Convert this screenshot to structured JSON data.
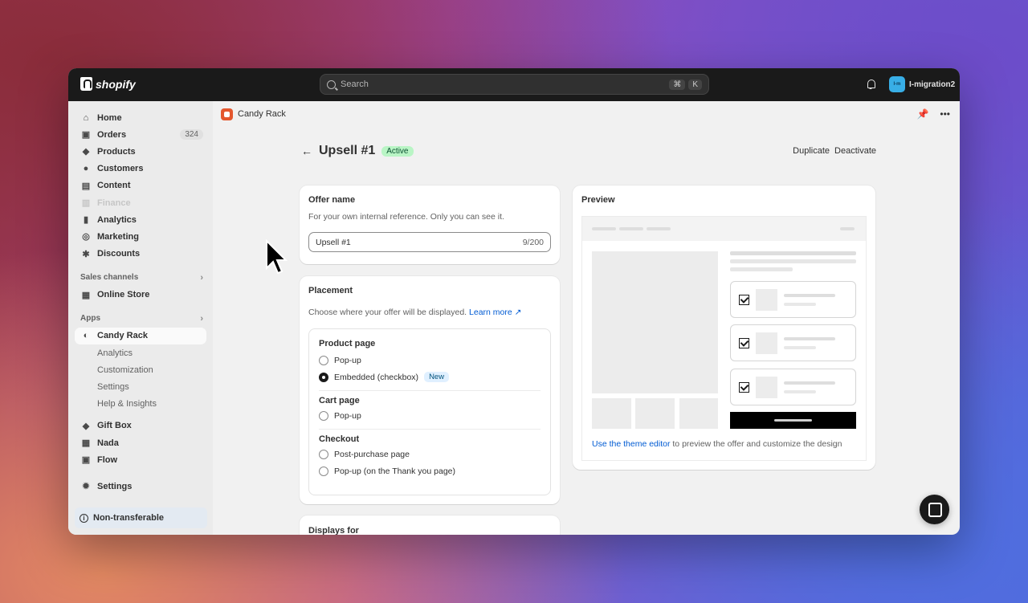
{
  "topbar": {
    "logo_text": "shopify",
    "search_placeholder": "Search",
    "shortcut_keys": [
      "⌘",
      "K"
    ],
    "user": {
      "initials": "I-m",
      "name": "I-migration2"
    }
  },
  "sidebar": {
    "items": [
      {
        "label": "Home",
        "icon": "home-icon",
        "glyph": "⌂"
      },
      {
        "label": "Orders",
        "icon": "orders-icon",
        "glyph": "▣",
        "badge": "324"
      },
      {
        "label": "Products",
        "icon": "tag-icon",
        "glyph": "◆"
      },
      {
        "label": "Customers",
        "icon": "person-icon",
        "glyph": "●"
      },
      {
        "label": "Content",
        "icon": "content-icon",
        "glyph": "▤"
      },
      {
        "label": "Finance",
        "icon": "bank-icon",
        "glyph": "▥",
        "disabled": true
      },
      {
        "label": "Analytics",
        "icon": "chart-icon",
        "glyph": "▮"
      },
      {
        "label": "Marketing",
        "icon": "target-icon",
        "glyph": "◎"
      },
      {
        "label": "Discounts",
        "icon": "discount-icon",
        "glyph": "✱"
      }
    ],
    "sales_channels_label": "Sales channels",
    "online_store": "Online Store",
    "apps_label": "Apps",
    "candy_rack": "Candy Rack",
    "candy_sub": [
      "Analytics",
      "Customization",
      "Settings",
      "Help & Insights"
    ],
    "other_apps": [
      "Gift Box",
      "Nada",
      "Flow"
    ],
    "settings": "Settings",
    "non_transferable": "Non-transferable"
  },
  "appbar": {
    "app_name": "Candy Rack"
  },
  "page": {
    "title": "Upsell #1",
    "status": "Active",
    "actions": [
      "Duplicate",
      "Deactivate"
    ]
  },
  "offer_name": {
    "heading": "Offer name",
    "help": "For your own internal reference. Only you can see it.",
    "value": "Upsell #1",
    "count": "9/200"
  },
  "placement": {
    "heading": "Placement",
    "help": "Choose where your offer will be displayed.",
    "learn_more": "Learn more",
    "product_page": {
      "title": "Product page",
      "options": [
        "Pop-up",
        "Embedded (checkbox)"
      ],
      "selected": "Embedded (checkbox)",
      "new_badge": "New"
    },
    "cart_page": {
      "title": "Cart page",
      "options": [
        "Pop-up"
      ]
    },
    "checkout": {
      "title": "Checkout",
      "options": [
        "Post-purchase page",
        "Pop-up (on the Thank you page)"
      ]
    }
  },
  "displays_for": {
    "heading": "Displays for"
  },
  "preview": {
    "heading": "Preview",
    "link": "Use the theme editor",
    "text": "to preview the offer and customize the design"
  }
}
